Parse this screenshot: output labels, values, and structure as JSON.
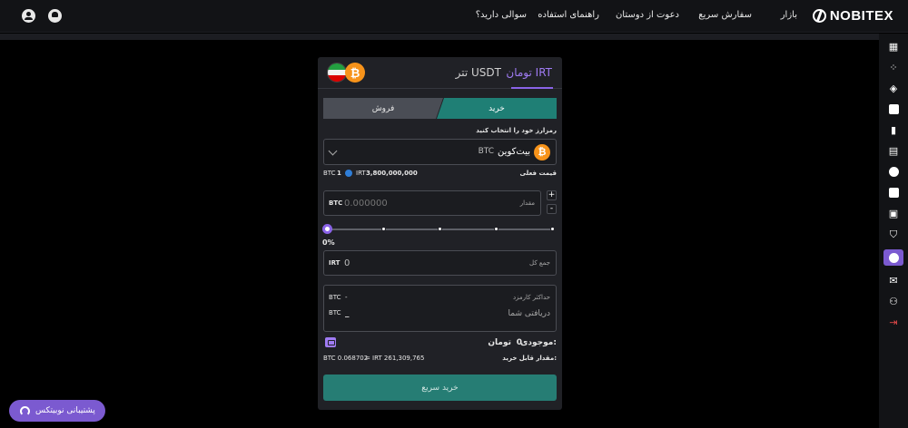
{
  "brand": {
    "name": "NOBITEX"
  },
  "topnav": {
    "items": [
      "بازار",
      "سفارش سریع",
      "دعوت از دوستان",
      "راهنمای استفاده",
      "سوالی دارید؟"
    ]
  },
  "panel": {
    "tabs": [
      {
        "label": "تومان IRT",
        "active": true
      },
      {
        "label": "تتر USDT",
        "active": false
      }
    ],
    "side": {
      "buy_label": "خرید",
      "sell_label": "فروش"
    },
    "choose_label": "رمزارز خود را انتخاب کنید",
    "selected_coin": {
      "name": "بیت‌کوین",
      "symbol": "BTC",
      "icon": "bitcoin-icon"
    },
    "price": {
      "label": "قیمت فعلی",
      "btc_amount": "1",
      "btc_unit": "BTC",
      "irt_unit": "IRT",
      "irt_value": "3,800,000,000"
    },
    "amount": {
      "label": "مقدار",
      "unit": "BTC",
      "placeholder": "0.000000",
      "plus": "+",
      "minus": "-"
    },
    "slider": {
      "percent_label": "0%",
      "level": 0
    },
    "total": {
      "label": "جمع کل",
      "unit": "IRT",
      "value": "0"
    },
    "fee": {
      "label": "حداکثر کارمزد",
      "unit": "BTC",
      "value": "-"
    },
    "received": {
      "label": "دریافتی شما",
      "unit": "BTC",
      "value": "_"
    },
    "balance": {
      "label": "موجودی:",
      "value": "0",
      "unit": "تومان"
    },
    "max_buy": {
      "label": "مقدار قابل خرید:",
      "btc": "BTC 0.068702",
      "equals": "=",
      "irt": "IRT 261,309,765"
    },
    "submit_label": "خرید سریع"
  },
  "support": {
    "label": "پشتیبانی نوبیتکس"
  },
  "colors": {
    "accent": "#8a63e8",
    "buy": "#1f7f75",
    "sell": "#4a4d55",
    "bitcoin": "#f7931a"
  }
}
